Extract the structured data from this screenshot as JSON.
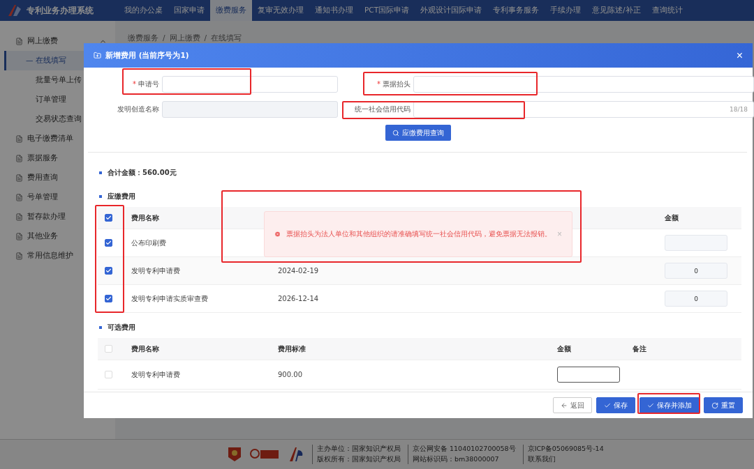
{
  "app": {
    "title": "专利业务办理系统"
  },
  "nav": [
    {
      "label": "我的办公桌",
      "selected": false
    },
    {
      "label": "国家申请",
      "selected": false
    },
    {
      "label": "缴费服务",
      "selected": true
    },
    {
      "label": "复审无效办理",
      "selected": false
    },
    {
      "label": "通知书办理",
      "selected": false
    },
    {
      "label": "PCT国际申请",
      "selected": false
    },
    {
      "label": "外观设计国际申请",
      "selected": false
    },
    {
      "label": "专利事务服务",
      "selected": false
    },
    {
      "label": "手续办理",
      "selected": false
    },
    {
      "label": "意见陈述/补正",
      "selected": false
    },
    {
      "label": "查询统计",
      "selected": false
    }
  ],
  "sidebar": {
    "items": [
      {
        "label": "网上缴费",
        "expanded": true,
        "children": [
          {
            "label": "在线填写",
            "selected": true
          },
          {
            "label": "批量号单上传",
            "selected": false
          },
          {
            "label": "订单管理",
            "selected": false
          },
          {
            "label": "交易状态查询",
            "selected": false
          }
        ]
      },
      {
        "label": "电子缴费清单",
        "expanded": false
      },
      {
        "label": "票据服务",
        "expanded": false
      },
      {
        "label": "费用查询",
        "expanded": false
      },
      {
        "label": "号单管理",
        "expanded": false
      },
      {
        "label": "暂存款办理",
        "expanded": false
      },
      {
        "label": "其他业务",
        "expanded": false
      },
      {
        "label": "常用信息维护",
        "expanded": false
      }
    ]
  },
  "breadcrumb": [
    "缴费服务",
    "网上缴费",
    "在线填写"
  ],
  "breadcrumb_separator": "/",
  "selected_marker": "—",
  "required_marker": "*",
  "dialog": {
    "title": "新增费用 (当前序号为1)",
    "close": "×",
    "fields": [
      {
        "label": "申请号",
        "required": true
      },
      {
        "label": "票据抬头",
        "required": true
      },
      {
        "label": "发明创造名称",
        "required": false,
        "disabled": true
      },
      {
        "label": "统一社会信用代码",
        "required": false,
        "counter": "18/18"
      }
    ],
    "query_button": "应缴费用查询",
    "total": "合计金额：560.00元",
    "due": {
      "title": "应缴费用",
      "columns": [
        "费用名称",
        "金额"
      ],
      "rows": [
        {
          "checked": true,
          "name": "公布印刷费",
          "date": "",
          "amount": ""
        },
        {
          "checked": true,
          "name": "发明专利申请费",
          "date": "2024-02-19",
          "amount": "0"
        },
        {
          "checked": true,
          "name": "发明专利申请实质审查费",
          "date": "2026-12-14",
          "amount": "0"
        }
      ],
      "all_checked": true
    },
    "optional": {
      "title": "可选费用",
      "columns": [
        "费用名称",
        "费用标准",
        "金额",
        "备注"
      ],
      "rows": [
        {
          "checked": false,
          "name": "发明专利申请费",
          "standard": "900.00",
          "amount": ""
        }
      ],
      "all_checked": false
    },
    "toast": {
      "message": "票据抬头为法人单位和其他组织的请准确填写统一社会信用代码，避免票据无法报销。",
      "close": "×"
    },
    "buttons": [
      {
        "label": "返回",
        "kind": "back"
      },
      {
        "label": "保存",
        "kind": "primary"
      },
      {
        "label": "保存并添加",
        "kind": "primary"
      },
      {
        "label": "重置",
        "kind": "reset"
      }
    ]
  },
  "footer": {
    "lines": [
      [
        "主办单位：国家知识产权局",
        "版权所有：国家知识产权局"
      ],
      [
        "京公网安备 11040102700058号",
        "网站标识码：bm38000007"
      ],
      [
        "京ICP备05069085号-14",
        "联系我们"
      ]
    ]
  }
}
